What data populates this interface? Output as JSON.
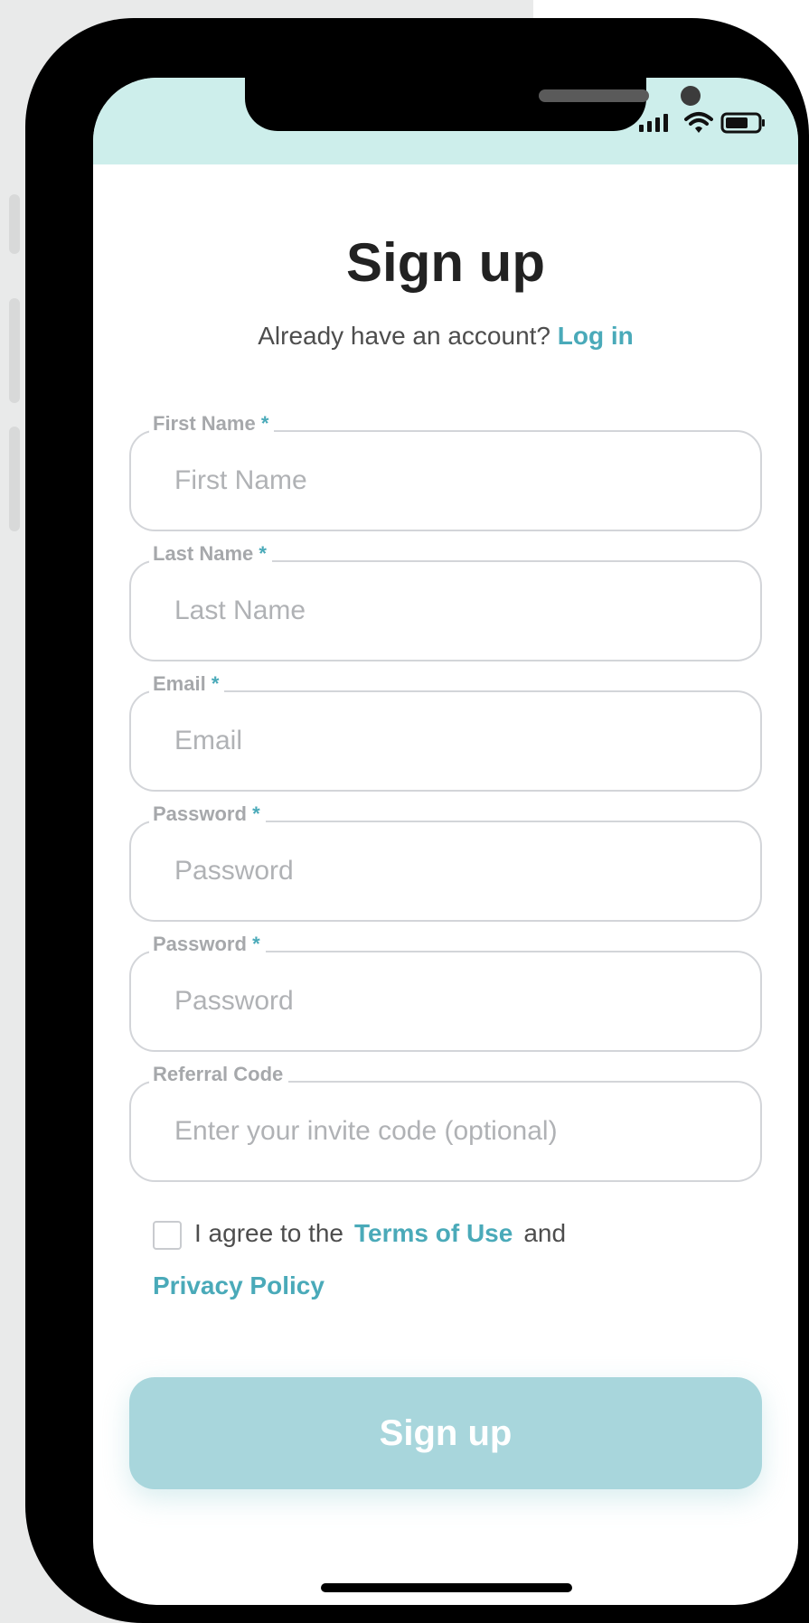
{
  "page": {
    "title": "Sign up",
    "login_prompt": "Already have an account?",
    "login_link": "Log in"
  },
  "fields": [
    {
      "label": "First Name",
      "required_mark": "*",
      "placeholder": "First Name",
      "value": ""
    },
    {
      "label": "Last Name",
      "required_mark": "*",
      "placeholder": "Last Name",
      "value": ""
    },
    {
      "label": "Email",
      "required_mark": "*",
      "placeholder": "Email",
      "value": ""
    },
    {
      "label": "Password",
      "required_mark": "*",
      "placeholder": "Password",
      "value": ""
    },
    {
      "label": "Password",
      "required_mark": "*",
      "placeholder": "Password",
      "value": ""
    },
    {
      "label": "Referral Code",
      "required_mark": "",
      "placeholder": "Enter your invite code (optional)",
      "value": ""
    }
  ],
  "agreement": {
    "prefix": "I agree to the",
    "terms_link": "Terms of Use",
    "conjunction": "and",
    "privacy_link": "Privacy Policy",
    "checked": false
  },
  "submit": {
    "label": "Sign up"
  },
  "status_bar": {
    "icons": [
      "signal-icon",
      "wifi-icon",
      "battery-icon"
    ]
  },
  "colors": {
    "accent": "#4aaab9",
    "button": "#a8d6dc",
    "status_bar": "#cdeeeb",
    "title": "#222222"
  }
}
